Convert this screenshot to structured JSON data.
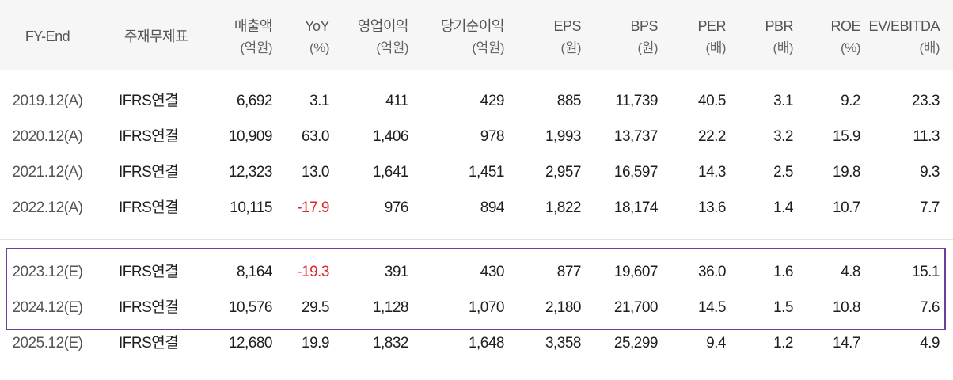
{
  "headers": [
    {
      "key": "fy",
      "label": "FY-End",
      "unit": ""
    },
    {
      "key": "basis",
      "label": "주재무제표",
      "unit": ""
    },
    {
      "key": "sales",
      "label": "매출액",
      "unit": "(억원)"
    },
    {
      "key": "yoy",
      "label": "YoY",
      "unit": "(%)"
    },
    {
      "key": "op",
      "label": "영업이익",
      "unit": "(억원)"
    },
    {
      "key": "net",
      "label": "당기순이익",
      "unit": "(억원)"
    },
    {
      "key": "eps",
      "label": "EPS",
      "unit": "(원)"
    },
    {
      "key": "bps",
      "label": "BPS",
      "unit": "(원)"
    },
    {
      "key": "per",
      "label": "PER",
      "unit": "(배)"
    },
    {
      "key": "pbr",
      "label": "PBR",
      "unit": "(배)"
    },
    {
      "key": "roe",
      "label": "ROE",
      "unit": "(%)"
    },
    {
      "key": "ev",
      "label": "EV/EBITDA",
      "unit": "(배)"
    }
  ],
  "rows": [
    {
      "fy": "2019.12(A)",
      "basis": "IFRS연결",
      "sales": "6,692",
      "yoy": "3.1",
      "op": "411",
      "net": "429",
      "eps": "885",
      "bps": "11,739",
      "per": "40.5",
      "pbr": "3.1",
      "roe": "9.2",
      "ev": "23.3"
    },
    {
      "fy": "2020.12(A)",
      "basis": "IFRS연결",
      "sales": "10,909",
      "yoy": "63.0",
      "op": "1,406",
      "net": "978",
      "eps": "1,993",
      "bps": "13,737",
      "per": "22.2",
      "pbr": "3.2",
      "roe": "15.9",
      "ev": "11.3"
    },
    {
      "fy": "2021.12(A)",
      "basis": "IFRS연결",
      "sales": "12,323",
      "yoy": "13.0",
      "op": "1,641",
      "net": "1,451",
      "eps": "2,957",
      "bps": "16,597",
      "per": "14.3",
      "pbr": "2.5",
      "roe": "19.8",
      "ev": "9.3"
    },
    {
      "fy": "2022.12(A)",
      "basis": "IFRS연결",
      "sales": "10,115",
      "yoy": "-17.9",
      "op": "976",
      "net": "894",
      "eps": "1,822",
      "bps": "18,174",
      "per": "13.6",
      "pbr": "1.4",
      "roe": "10.7",
      "ev": "7.7"
    },
    {
      "fy": "2023.12(E)",
      "basis": "IFRS연결",
      "sales": "8,164",
      "yoy": "-19.3",
      "op": "391",
      "net": "430",
      "eps": "877",
      "bps": "19,607",
      "per": "36.0",
      "pbr": "1.6",
      "roe": "4.8",
      "ev": "15.1"
    },
    {
      "fy": "2024.12(E)",
      "basis": "IFRS연결",
      "sales": "10,576",
      "yoy": "29.5",
      "op": "1,128",
      "net": "1,070",
      "eps": "2,180",
      "bps": "21,700",
      "per": "14.5",
      "pbr": "1.5",
      "roe": "10.8",
      "ev": "7.6"
    },
    {
      "fy": "2025.12(E)",
      "basis": "IFRS연결",
      "sales": "12,680",
      "yoy": "19.9",
      "op": "1,832",
      "net": "1,648",
      "eps": "3,358",
      "bps": "25,299",
      "per": "9.4",
      "pbr": "1.2",
      "roe": "14.7",
      "ev": "4.9"
    }
  ],
  "colors": {
    "negative": "#e0242a",
    "highlight_border": "#6b3fa0",
    "header_bg": "#f6f6f6"
  }
}
